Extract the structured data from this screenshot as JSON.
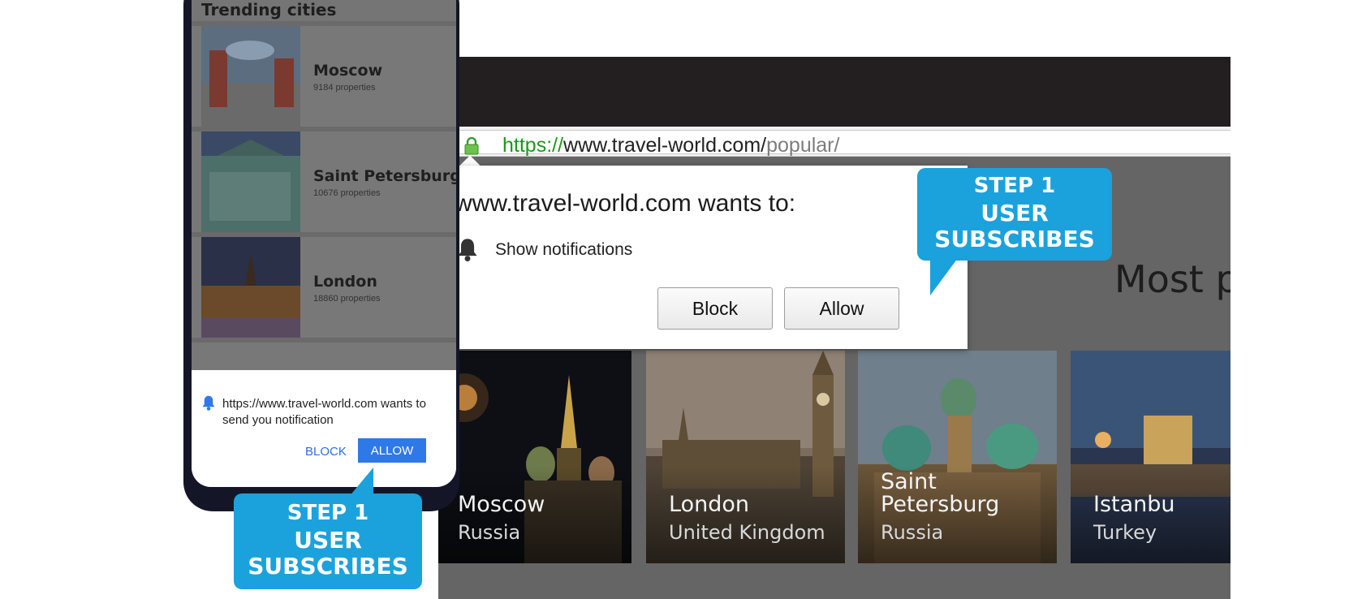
{
  "desktop": {
    "url": {
      "protocol": "https://",
      "host": "www.travel-world.com/",
      "path": "popular/"
    },
    "page_heading": "Most p",
    "permission_prompt": {
      "title": "www.travel-world.com wants to:",
      "permission": "Show notifications",
      "block_label": "Block",
      "allow_label": "Allow"
    },
    "callout": {
      "line1": "STEP 1",
      "line2": "USER",
      "line3": "SUBSCRIBES"
    },
    "cards": [
      {
        "city": "Moscow",
        "country": "Russia"
      },
      {
        "city": "London",
        "country": "United Kingdom"
      },
      {
        "city": "Saint Petersburg",
        "country": "Russia"
      },
      {
        "city": "Istanbu",
        "country": "Turkey"
      }
    ]
  },
  "mobile": {
    "section_title": "Trending cities",
    "cities": [
      {
        "name": "Moscow",
        "properties": "9184 properties"
      },
      {
        "name": "Saint Petersburg",
        "properties": "10676 properties"
      },
      {
        "name": "London",
        "properties": "18860 properties"
      }
    ],
    "notification": {
      "message": "https://www.travel-world.com wants to send you notification",
      "block_label": "BLOCK",
      "allow_label": "ALLOW"
    },
    "callout": {
      "line1": "STEP 1",
      "line2": "USER",
      "line3": "SUBSCRIBES"
    }
  },
  "colors": {
    "accent": "#1ba2dc",
    "allow_blue": "#2f78e8",
    "https_green": "#1a9a1a"
  }
}
